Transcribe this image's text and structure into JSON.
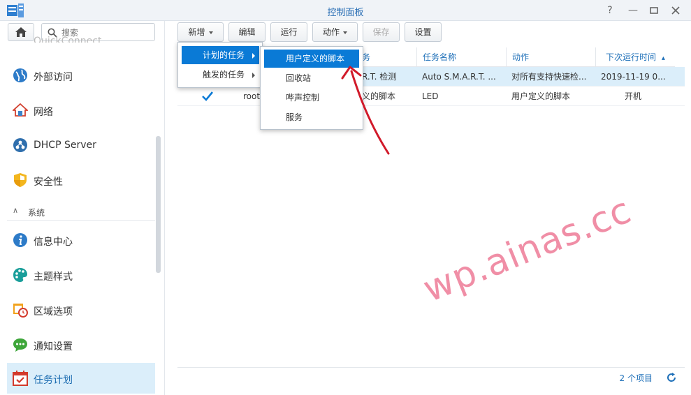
{
  "window": {
    "title": "控制面板",
    "help": "?",
    "minimize": "—",
    "maximize": "□",
    "close": "✕"
  },
  "sidebar": {
    "search_placeholder": "搜索",
    "cut_item": "QuickConnect",
    "items": [
      {
        "label": "外部访问",
        "icon": "globe-icon"
      },
      {
        "label": "网络",
        "icon": "home-network-icon"
      },
      {
        "label": "DHCP Server",
        "icon": "dhcp-icon"
      },
      {
        "label": "安全性",
        "icon": "shield-icon"
      }
    ],
    "section": {
      "chevron": "∧",
      "label": "系统"
    },
    "system_items": [
      {
        "label": "信息中心",
        "icon": "info-icon"
      },
      {
        "label": "主题样式",
        "icon": "palette-icon"
      },
      {
        "label": "区域选项",
        "icon": "clock-calendar-icon"
      },
      {
        "label": "通知设置",
        "icon": "chat-icon"
      },
      {
        "label": "任务计划",
        "icon": "task-calendar-icon"
      }
    ]
  },
  "toolbar": {
    "create": "新增",
    "edit": "编辑",
    "run": "运行",
    "action": "动作",
    "save": "保存",
    "settings": "设置"
  },
  "grid": {
    "columns": [
      "",
      "",
      "任务名称",
      "动作",
      "下次运行时间"
    ],
    "sort_indicator": "▴",
    "rows": [
      {
        "user": "",
        "type_partial": "R.T. 检测",
        "name": "Auto S.M.A.R.T. ...",
        "action": "对所有支持快速检...",
        "next_run": "2019-11-19 0..."
      },
      {
        "user": "root",
        "type_partial": "义的脚本",
        "name": "LED",
        "action": "用户定义的脚本",
        "next_run": "开机"
      }
    ],
    "header_partial": "务"
  },
  "footer": {
    "count": "2 个项目"
  },
  "menus": {
    "create_menu": [
      "计划的任务",
      "触发的任务"
    ],
    "submenu": [
      "用户定义的脚本",
      "回收站",
      "哔声控制",
      "服务"
    ]
  },
  "watermark": "wp.ainas.cc",
  "colors": {
    "accent": "#0a7ad6",
    "selection": "#dbeefa",
    "header_text": "#1d6fb8",
    "annotation": "#d11a2a",
    "watermark": "#f08ea6"
  }
}
